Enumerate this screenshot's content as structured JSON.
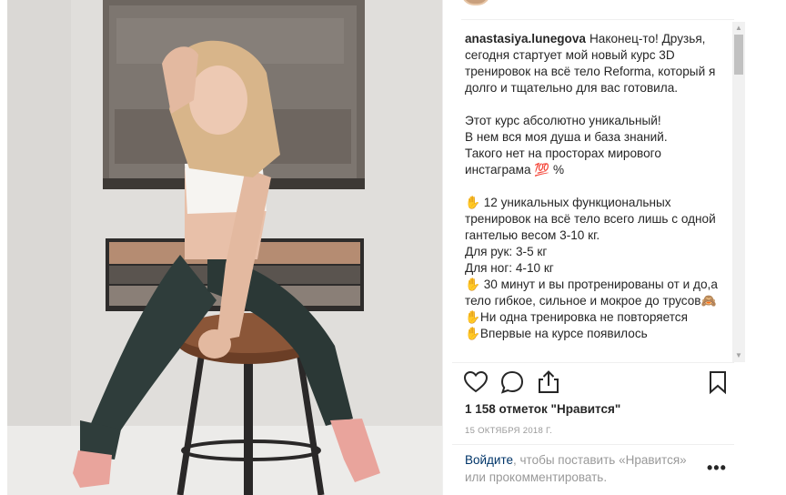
{
  "post": {
    "username": "anastasiya.lunegova",
    "caption": "Наконец-то! Друзья, сегодня стартует мой новый курс 3D тренировок на всё тело Reforma, который я долго и тщательно для вас готовила.\n\nЭтот курс абсолютно уникальный!\nВ нем вся моя душа и база знаний.\nТакого нет на просторах мирового инстаграма 💯 %\n\n✋ 12 уникальных функциональных тренировок на всё тело всего лишь с одной гантелью весом 3-10 кг.\nДля рук: 3-5 кг\nДля ног: 4-10 кг\n✋ 30 минут и вы протренированы от и до,а тело гибкое, сильное и мокрое до трусов🙈\n✋Ни одна тренировка не повторяется\n✋Впервые на курсе появилось",
    "likes": "1 158 отметок \"Нравится\"",
    "date": "15 ОКТЯБРЯ 2018 Г.",
    "login_link": "Войдите",
    "login_text": ", чтобы поставить «Нравится» или прокомментировать.",
    "more_label": "•••"
  },
  "icons": {
    "like": "heart-icon",
    "comment": "comment-icon",
    "share": "share-icon",
    "save": "bookmark-icon",
    "scroll_up": "▲",
    "scroll_down": "▼"
  },
  "colors": {
    "text": "#262626",
    "muted": "#999999",
    "link": "#003569",
    "divider": "#efefef"
  }
}
